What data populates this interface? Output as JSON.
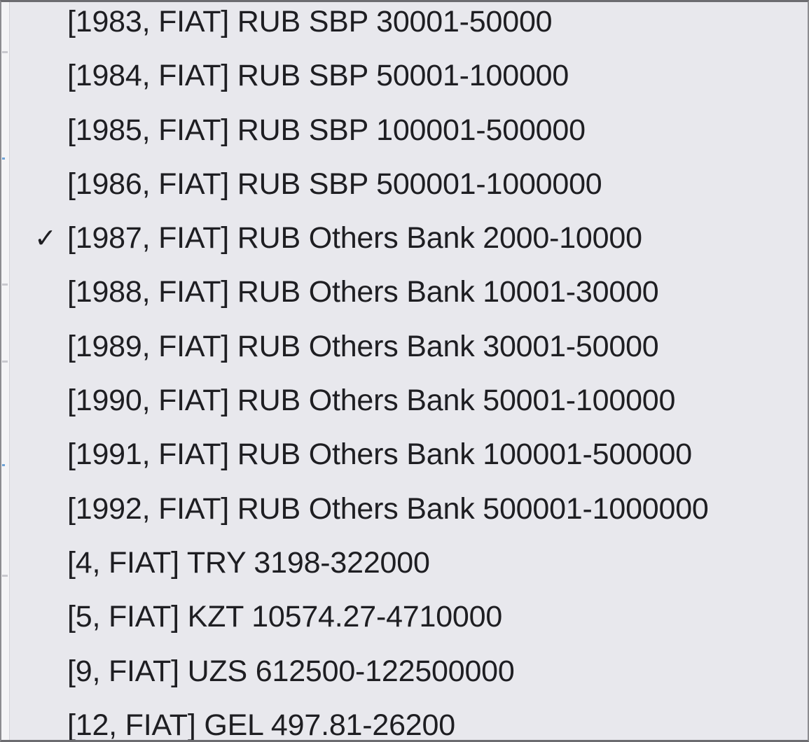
{
  "menu": {
    "items": [
      {
        "label": "[1983, FIAT] RUB SBP 30001-50000",
        "checked": false
      },
      {
        "label": "[1984, FIAT] RUB SBP 50001-100000",
        "checked": false
      },
      {
        "label": "[1985, FIAT] RUB SBP 100001-500000",
        "checked": false
      },
      {
        "label": "[1986, FIAT] RUB SBP 500001-1000000",
        "checked": false
      },
      {
        "label": "[1987, FIAT] RUB Others Bank 2000-10000",
        "checked": true,
        "check_glyph": "✓"
      },
      {
        "label": "[1988, FIAT] RUB Others Bank 10001-30000",
        "checked": false
      },
      {
        "label": "[1989, FIAT] RUB Others Bank 30001-50000",
        "checked": false
      },
      {
        "label": "[1990, FIAT] RUB Others Bank 50001-100000",
        "checked": false
      },
      {
        "label": "[1991, FIAT] RUB Others Bank 100001-500000",
        "checked": false
      },
      {
        "label": "[1992, FIAT] RUB Others Bank 500001-1000000",
        "checked": false
      },
      {
        "label": "[4, FIAT] TRY 3198-322000",
        "checked": false
      },
      {
        "label": "[5, FIAT] KZT 10574.27-4710000",
        "checked": false
      },
      {
        "label": "[9, FIAT] UZS 612500-122500000",
        "checked": false
      },
      {
        "label": "[12, FIAT] GEL 497.81-26200",
        "checked": false
      }
    ]
  },
  "colors": {
    "menu_background": "#e8e8ed",
    "text": "#1e1e22",
    "border": "#6c6c70"
  },
  "icons": {
    "selected": "checkmark-icon"
  }
}
